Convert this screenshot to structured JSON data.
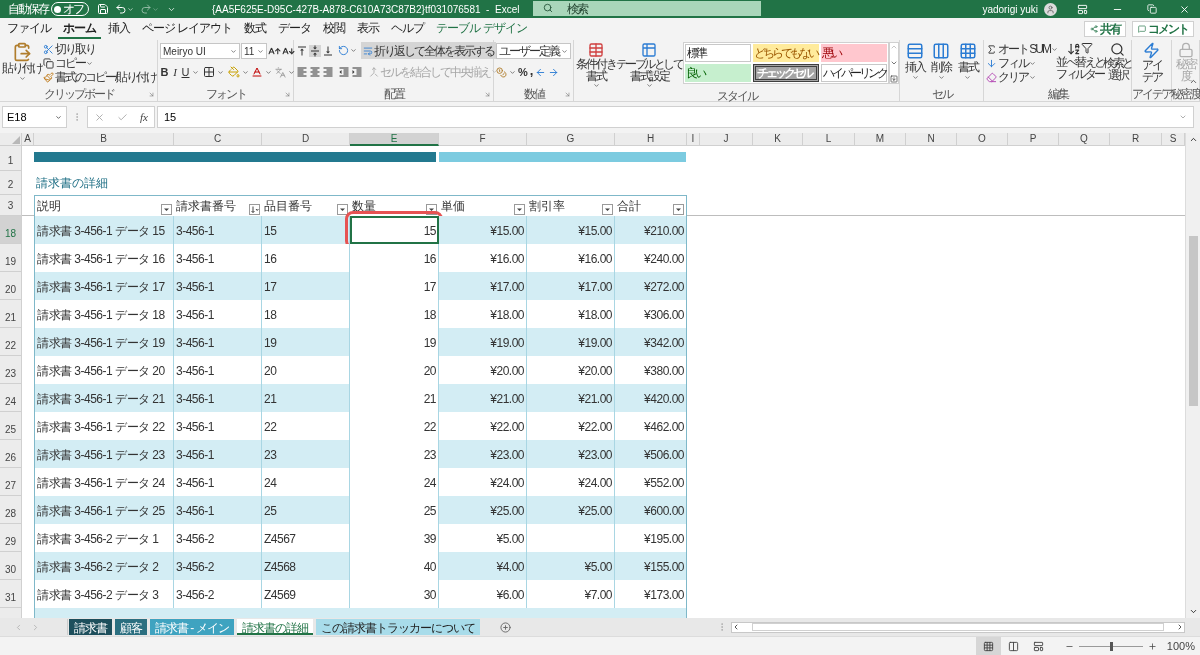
{
  "title_bar": {
    "autosave_label": "自動保存",
    "autosave": {
      "label": "オフ",
      "on": false
    },
    "title": "{AA5F625E-D95C-427B-A878-C610A73C87B2}tf031076581  -  Excel",
    "search": {
      "placeholder": "検索"
    },
    "user": "yadorigi yuki"
  },
  "ribbon_tabs": [
    {
      "label": "ファイル",
      "selected": false,
      "kind": "normal"
    },
    {
      "label": "ホーム",
      "selected": true,
      "kind": "normal"
    },
    {
      "label": "挿入",
      "selected": false,
      "kind": "normal"
    },
    {
      "label": "ページ レイアウト",
      "selected": false,
      "kind": "normal"
    },
    {
      "label": "数式",
      "selected": false,
      "kind": "normal"
    },
    {
      "label": "データ",
      "selected": false,
      "kind": "normal"
    },
    {
      "label": "校閲",
      "selected": false,
      "kind": "normal"
    },
    {
      "label": "表示",
      "selected": false,
      "kind": "normal"
    },
    {
      "label": "ヘルプ",
      "selected": false,
      "kind": "normal"
    },
    {
      "label": "テーブル デザイン",
      "selected": false,
      "kind": "contextual"
    }
  ],
  "share_button": "共有",
  "comment_button": "コメント",
  "ribbon": {
    "clipboard": {
      "label": "クリップボード",
      "paste": "貼り付け",
      "cut": "切り取り",
      "copy": "コピー",
      "format_painter": "書式のコピー/貼り付け"
    },
    "font": {
      "label": "フォント",
      "font_name": "Meiryo UI",
      "font_size": "11",
      "bold": "B",
      "italic": "I",
      "underline": "U"
    },
    "alignment": {
      "label": "配置",
      "wrap_text": {
        "label": "折り返して全体を表示する",
        "on": true
      },
      "merge": {
        "label": "セルを結合して中央揃え",
        "disabled": true
      }
    },
    "number": {
      "label": "数値",
      "format": "ユーザー定義",
      "percent": "%",
      "comma": ","
    },
    "styles": {
      "label": "スタイル",
      "conditional": [
        "条件付き",
        "書式"
      ],
      "format_as_table": [
        "テーブルとして",
        "書式設定"
      ],
      "cell_styles": [
        {
          "label": "標準",
          "kind": "normal",
          "color": "#ffffff"
        },
        {
          "label": "どちらでもない",
          "kind": "neutral",
          "color": "#ffeb9c"
        },
        {
          "label": "悪い",
          "kind": "bad",
          "color": "#ffc7ce"
        },
        {
          "label": "良い",
          "kind": "good",
          "color": "#c6efce"
        },
        {
          "label": "チェック セル",
          "kind": "check",
          "color": "#a5a5a5"
        },
        {
          "label": "ハイパーリンク",
          "kind": "normal",
          "color": "#ffffff"
        }
      ]
    },
    "cells": {
      "label": "セル",
      "insert": "挿入",
      "delete": "削除",
      "format": "書式"
    },
    "editing": {
      "label": "編集",
      "autosum": "オート SUM",
      "fill": "フィル",
      "clear": "クリア",
      "sort_filter": [
        "並べ替えと",
        "フィルター"
      ],
      "find_select": [
        "検索と",
        "選択"
      ]
    },
    "ideas": {
      "label": "アイデア",
      "button": [
        "アイ",
        "デア"
      ]
    },
    "sensitivity": {
      "label": "秘密度",
      "button": [
        "秘密",
        "度"
      ],
      "disabled": true
    }
  },
  "formula_bar": {
    "name_box": "E18",
    "function_button": "fx",
    "formula": "15"
  },
  "columns": [
    {
      "label": "A",
      "selected": false
    },
    {
      "label": "B",
      "selected": false
    },
    {
      "label": "C",
      "selected": false
    },
    {
      "label": "D",
      "selected": false
    },
    {
      "label": "E",
      "selected": true
    },
    {
      "label": "F",
      "selected": false
    },
    {
      "label": "G",
      "selected": false
    },
    {
      "label": "H",
      "selected": false
    },
    {
      "label": "I",
      "selected": false
    },
    {
      "label": "J",
      "selected": false
    },
    {
      "label": "K",
      "selected": false
    },
    {
      "label": "L",
      "selected": false
    },
    {
      "label": "M",
      "selected": false
    },
    {
      "label": "N",
      "selected": false
    },
    {
      "label": "O",
      "selected": false
    },
    {
      "label": "P",
      "selected": false
    },
    {
      "label": "Q",
      "selected": false
    },
    {
      "label": "R",
      "selected": false
    },
    {
      "label": "S",
      "selected": false
    }
  ],
  "sheet": {
    "top_rows": [
      "1",
      "2",
      "3"
    ],
    "title": "請求書の詳細",
    "table_columns": [
      {
        "label": "説明",
        "sorted": false
      },
      {
        "label": "請求書番号",
        "sorted": true
      },
      {
        "label": "品目番号",
        "sorted": false
      },
      {
        "label": "数量",
        "sorted": false
      },
      {
        "label": "単価",
        "sorted": false
      },
      {
        "label": "割引率",
        "sorted": false
      },
      {
        "label": "合計",
        "sorted": false
      }
    ],
    "rows": [
      {
        "number": "18",
        "selected": true,
        "cells": [
          "請求書 3-456-1 データ 15",
          "3-456-1",
          "15",
          "15",
          "¥15.00",
          "¥15.00",
          "¥210.00"
        ]
      },
      {
        "number": "19",
        "selected": false,
        "cells": [
          "請求書 3-456-1 データ 16",
          "3-456-1",
          "16",
          "16",
          "¥16.00",
          "¥16.00",
          "¥240.00"
        ]
      },
      {
        "number": "20",
        "selected": false,
        "cells": [
          "請求書 3-456-1 データ 17",
          "3-456-1",
          "17",
          "17",
          "¥17.00",
          "¥17.00",
          "¥272.00"
        ]
      },
      {
        "number": "21",
        "selected": false,
        "cells": [
          "請求書 3-456-1 データ 18",
          "3-456-1",
          "18",
          "18",
          "¥18.00",
          "¥18.00",
          "¥306.00"
        ]
      },
      {
        "number": "22",
        "selected": false,
        "cells": [
          "請求書 3-456-1 データ 19",
          "3-456-1",
          "19",
          "19",
          "¥19.00",
          "¥19.00",
          "¥342.00"
        ]
      },
      {
        "number": "23",
        "selected": false,
        "cells": [
          "請求書 3-456-1 データ 20",
          "3-456-1",
          "20",
          "20",
          "¥20.00",
          "¥20.00",
          "¥380.00"
        ]
      },
      {
        "number": "24",
        "selected": false,
        "cells": [
          "請求書 3-456-1 データ 21",
          "3-456-1",
          "21",
          "21",
          "¥21.00",
          "¥21.00",
          "¥420.00"
        ]
      },
      {
        "number": "25",
        "selected": false,
        "cells": [
          "請求書 3-456-1 データ 22",
          "3-456-1",
          "22",
          "22",
          "¥22.00",
          "¥22.00",
          "¥462.00"
        ]
      },
      {
        "number": "26",
        "selected": false,
        "cells": [
          "請求書 3-456-1 データ 23",
          "3-456-1",
          "23",
          "23",
          "¥23.00",
          "¥23.00",
          "¥506.00"
        ]
      },
      {
        "number": "27",
        "selected": false,
        "cells": [
          "請求書 3-456-1 データ 24",
          "3-456-1",
          "24",
          "24",
          "¥24.00",
          "¥24.00",
          "¥552.00"
        ]
      },
      {
        "number": "28",
        "selected": false,
        "cells": [
          "請求書 3-456-1 データ 25",
          "3-456-1",
          "25",
          "25",
          "¥25.00",
          "¥25.00",
          "¥600.00"
        ]
      },
      {
        "number": "29",
        "selected": false,
        "cells": [
          "請求書 3-456-2 データ 1",
          "3-456-2",
          "Z4567",
          "39",
          "¥5.00",
          null,
          "¥195.00"
        ]
      },
      {
        "number": "30",
        "selected": false,
        "cells": [
          "請求書 3-456-2 データ 2",
          "3-456-2",
          "Z4568",
          "40",
          "¥4.00",
          "¥5.00",
          "¥155.00"
        ]
      },
      {
        "number": "31",
        "selected": false,
        "cells": [
          "請求書 3-456-2 データ 3",
          "3-456-2",
          "Z4569",
          "30",
          "¥6.00",
          "¥7.00",
          "¥173.00"
        ]
      }
    ]
  },
  "sheet_tabs": [
    {
      "label": "請求書",
      "selected": false,
      "color": "#1d4f5c"
    },
    {
      "label": "顧客",
      "selected": false,
      "color": "#2b6f80"
    },
    {
      "label": "請求書 - メイン",
      "selected": false,
      "color": "#3fa3c0"
    },
    {
      "label": "請求書の詳細",
      "selected": true,
      "color": "#ffffff"
    },
    {
      "label": "この請求書トラッカーについて",
      "selected": false,
      "color": "#a8dcea"
    }
  ],
  "status_bar": {
    "views": [
      {
        "kind": "normal",
        "selected": true
      },
      {
        "kind": "page-layout",
        "selected": false
      },
      {
        "kind": "page-break",
        "selected": false
      }
    ],
    "zoom": {
      "label": "100%",
      "level": 0.5
    }
  }
}
